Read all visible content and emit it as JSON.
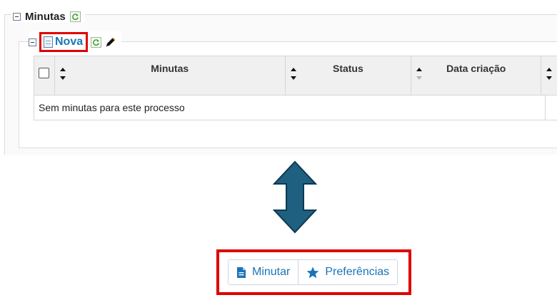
{
  "minutas_section": {
    "title": "Minutas",
    "refresh_icon": "refresh-icon",
    "collapse_icon": "collapse-icon"
  },
  "inner_section": {
    "new_label": "Nova",
    "new_icon": "document-icon",
    "refresh_icon": "refresh-icon",
    "edit_icon": "pen-icon"
  },
  "table": {
    "columns": [
      "Minutas",
      "Status",
      "Data criação"
    ],
    "empty_message": "Sem minutas para este processo"
  },
  "arrow_icon": "double-arrow-vertical-icon",
  "toolbar": {
    "buttons": [
      {
        "label": "Minutar",
        "icon": "document-icon"
      },
      {
        "label": "Preferências",
        "icon": "star-icon"
      }
    ]
  },
  "colors": {
    "link_blue": "#1a74b8",
    "highlight_red": "#e00000",
    "arrow_fill": "#1f5f80"
  }
}
